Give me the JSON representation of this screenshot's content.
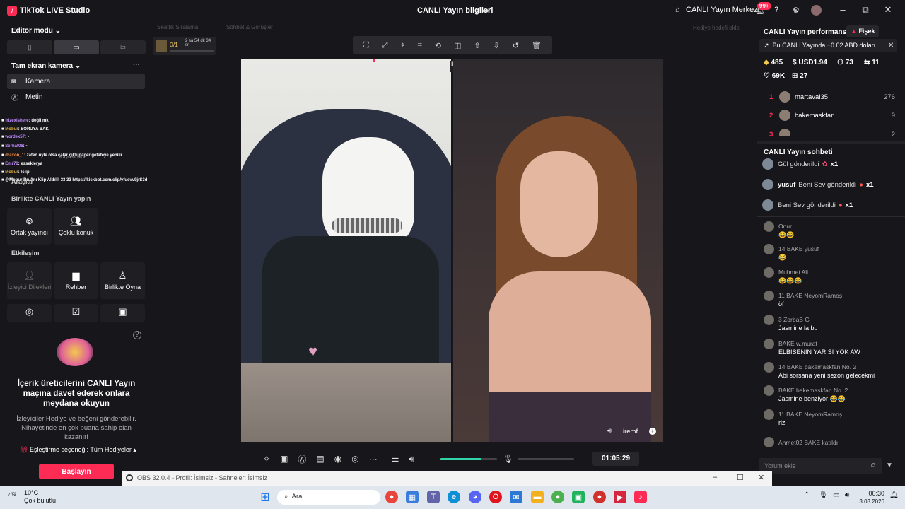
{
  "titlebar": {
    "app_title": "TikTok LIVE Studio",
    "center_title": "CANLI Yayın bilgileri",
    "live_center": "CANLI Yayın Merkezi",
    "notif_badge": "99+"
  },
  "left": {
    "editor_mode": "Editör modu",
    "scene_label": "Tam ekran kamera",
    "sources": [
      "Kamera",
      "Metin"
    ],
    "tools_label": "Araçlar",
    "together_label": "Birlikte CANLI Yayın yapın",
    "together_tiles": [
      "Ortak yayıncı",
      "Çoklu konuk"
    ],
    "interaction_label": "Etkileşim",
    "interaction_tiles": [
      "İzleyici Dilekleri",
      "Rehber",
      "Birlikte Oyna"
    ],
    "overlay_chat": [
      {
        "name": "frizexishere",
        "text": ": değil mk"
      },
      {
        "name": "Mobur",
        "text": ": SORUYA BAK"
      },
      {
        "name": "wordex57",
        "text": ":"
      },
      {
        "name": "Serhat06",
        "text": ":"
      },
      {
        "name": "draxon_1",
        "text": ": zaten öyle olsa çalar çıktı paper getafeye yenilir"
      },
      {
        "name": "Emr76",
        "text": ": esseklerya"
      },
      {
        "name": "Mobur",
        "text": ": !clip"
      },
      {
        "name": "@Mobur",
        "text": "Bu Anı Klip Aldı!!! 33 33 https://kickbot.com/clip/yfuevv9jrS3d"
      }
    ],
    "overlay_extra": "Kaynak ekle"
  },
  "promo": {
    "title": "İçerik üreticilerini CANLI Yayın maçına davet ederek onlara meydana okuyun",
    "subtitle": "İzleyiciler Hediye ve beğeni gönderebilir. Nihayetinde en çok puana sahip olan kazanır!",
    "option": "Eşleştirme seçeneği: Tüm Hediyeler",
    "button": "Başlayın"
  },
  "stage": {
    "top_left_faint": "Seatlik Sıralama",
    "top_mid_faint": "Sohbet & Görüşler",
    "top_right_faint": "Hediye hedefi ekle",
    "mini_counter": "0/1",
    "mini_time": "2 sa 54 dk 34 sn",
    "right_video_name": "iremf...",
    "timer": "01:05:29",
    "volume_level": 0.45
  },
  "right": {
    "perf_title": "CANLI Yayın performansı",
    "fisek": "Fişek",
    "promo_line": "Bu CANLI Yayında +0.02 ABD doları",
    "stats": {
      "diamonds": "485",
      "usd": "USD1.94",
      "viewers": "73",
      "joined": "11",
      "likes": "69K",
      "gifts": "27"
    },
    "ranking": [
      {
        "rank": "1",
        "name": "martaval35",
        "score": "276"
      },
      {
        "rank": "2",
        "name": "bakemaskfan",
        "score": "9"
      },
      {
        "rank": "3",
        "name": "",
        "score": "2"
      }
    ],
    "chat_title": "CANLI Yayın sohbeti",
    "gifts": [
      {
        "name": "",
        "text": "Gül gönderildi",
        "count": "x1"
      },
      {
        "name": "yusuf",
        "text": "Beni Sev gönderildi",
        "count": "x1"
      },
      {
        "name": "",
        "text": "Beni Sev gönderildi",
        "count": "x1"
      }
    ],
    "messages": [
      {
        "meta": "Onur",
        "text": "😂😂"
      },
      {
        "meta": "14 BAKE yusuf",
        "text": "😂"
      },
      {
        "meta": "Muhmet Ali",
        "text": "😂😂😂"
      },
      {
        "meta": "11 BAKE NeyomRamoş",
        "text": "öf"
      },
      {
        "meta": "3 ZorbaB G",
        "text": "Jasmine la bu"
      },
      {
        "meta": "BAKE w.murat",
        "text": "ELBİSENİN YARISI YOK AW"
      },
      {
        "meta": "14 BAKE bakemaskfan No. 2",
        "text": "Abi sorsana yeni sezon gelecekmi"
      },
      {
        "meta": "BAKE bakemaskfan No. 2",
        "text": "Jasmine benziyor 😂😂"
      },
      {
        "meta": "11 BAKE NeyomRamoş",
        "text": "riz"
      },
      {
        "meta": "Ahmet02 BAKE katıldı",
        "text": ""
      }
    ],
    "comment_placeholder": "Yorum ekle"
  },
  "obs": {
    "title": "OBS 32.0.4 - Profil: İsimsiz - Sahneler: İsimsiz"
  },
  "taskbar": {
    "weather_temp": "10°C",
    "weather_desc": "Çok bulutlu",
    "search": "Ara",
    "time": "00:30",
    "date": "3.03.2026"
  }
}
